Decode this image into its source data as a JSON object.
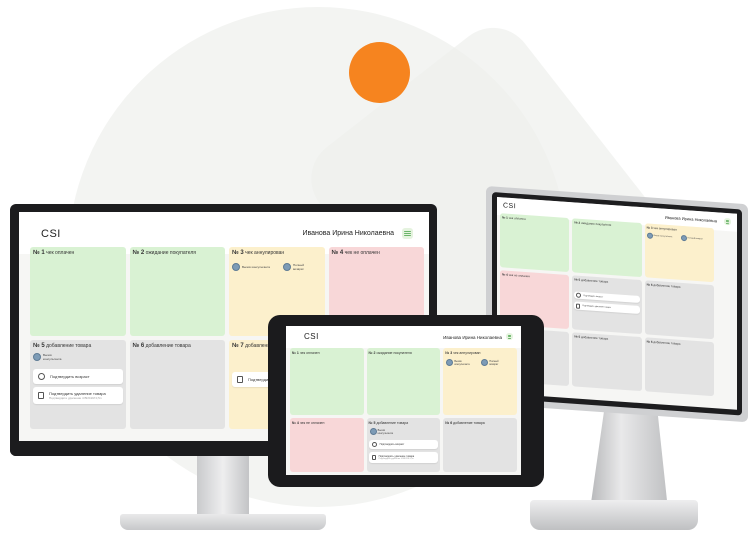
{
  "app": {
    "logo": "CSI",
    "user_name": "Иванова Ирина Николаевна"
  },
  "tiles": [
    {
      "num": "№ 1",
      "label": "чек оплачен",
      "status": "green"
    },
    {
      "num": "№ 2",
      "label": "ожидание покупателя",
      "status": "green"
    },
    {
      "num": "№ 3",
      "label": "чек аннулирован",
      "status": "yellow"
    },
    {
      "num": "№ 4",
      "label": "чек не оплачен",
      "status": "red"
    },
    {
      "num": "№ 5",
      "label": "добавление товара",
      "status": "gray"
    },
    {
      "num": "№ 6",
      "label": "добавление товара",
      "status": "gray"
    },
    {
      "num": "№ 7",
      "label": "добавление товара",
      "status": "yellow"
    }
  ],
  "pills": {
    "call_consultant": "Вызов консультанта",
    "full_return": "Полный возврат"
  },
  "actions": {
    "confirm_age": "Подтвердить возраст",
    "confirm_delete": "Подтвердить удаление товара",
    "confirm_delete_short": "Подтвердить",
    "delete_sub": "Подтвердите удаление 4 ВИСКИ 0,5л"
  },
  "colors": {
    "accent_orange": "#f6841f",
    "paid_green": "#d9f2d3",
    "unpaid_red": "#f8d7d8",
    "cancelled_yellow": "#fcf0cc",
    "adding_gray": "#e3e3e3"
  }
}
